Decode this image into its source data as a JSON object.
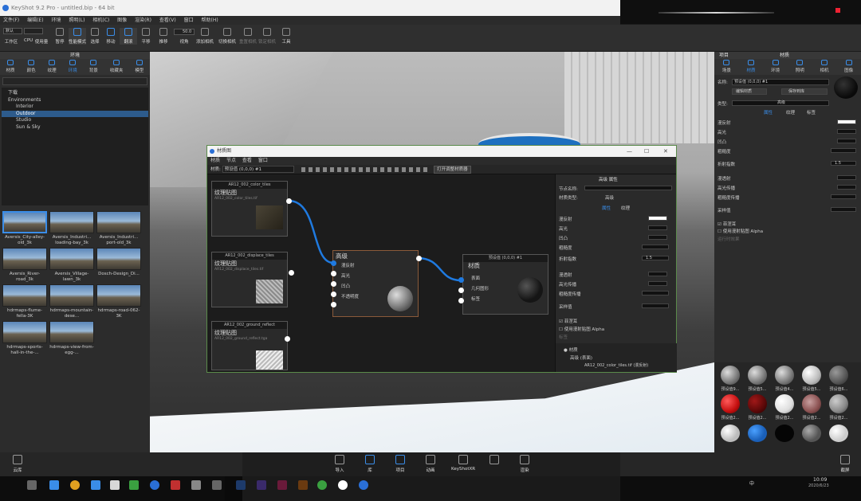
{
  "window": {
    "title": "KeyShot 9.2 Pro - untitled.bip - 64 bit"
  },
  "menubar": [
    "文件(F)",
    "编辑(E)",
    "环境",
    "照明(L)",
    "相机(C)",
    "图像",
    "渲染(R)",
    "查看(V)",
    "窗口",
    "帮助(H)"
  ],
  "toolbar": {
    "workspace": "默认",
    "cpu": "CPU",
    "cpu_usage": "使用量",
    "pause": "暂停",
    "perf": "性能模式",
    "items": [
      "选择",
      "移动",
      "翻滚",
      "平移",
      "推移",
      "视角",
      "添加相机",
      "切换相机",
      "重置相机",
      "锁定相机",
      "工具"
    ],
    "zoom": "50.0"
  },
  "left_panel": {
    "title": "环境",
    "tabs": [
      "材质",
      "颜色",
      "纹理",
      "环境",
      "背景",
      "收藏夹",
      "模型"
    ],
    "tree": [
      "下载",
      "Environments",
      "Interior",
      "Outdoor",
      "Studio",
      "Sun & Sky"
    ],
    "thumbs": [
      "Aversis_City-alley-old_3k",
      "Aversis_Industri... loading-bay_3k",
      "Aversis_Industri... port-old_3k",
      "Aversis_River-road_3k",
      "Aversis_Village-lawn_3k",
      "Dosch-Design_Di...",
      "hdrmaps-flume-fella-3K",
      "hdrmaps-mountain-dese...",
      "hdrmaps-road-062-3K",
      "hdrmaps-sports-hall-in-the-...",
      "hdrmaps-view-from-egg-..."
    ]
  },
  "node_window": {
    "title": "材质图",
    "menu": [
      "材质",
      "节点",
      "查看",
      "窗口"
    ],
    "material_label": "材质:",
    "material_value": "预设值 (0,0,0) #1",
    "tool_btn": "打开调整材质器",
    "nodes": {
      "tex1_header": "AR12_002_color_tiles",
      "tex1_title": "纹理贴图",
      "tex1_file": "AR12_002_color_tiles.tif",
      "tex2_header": "AR12_002_displace_tiles",
      "tex2_title": "纹理贴图",
      "tex2_file": "AR12_002_displace_tiles.tif",
      "tex3_header": "AR12_002_ground_reflect",
      "tex3_title": "纹理贴图",
      "tex3_file": "AR12_002_ground_reflect.tga",
      "mat_title": "高级",
      "mat_ports": [
        "漫反射",
        "高光",
        "凹凸",
        "不透明度",
        ""
      ],
      "out_header": "预设值 (0,0,0) #1",
      "out_title": "材质",
      "out_ports": [
        "表面",
        "几何图形",
        "标签"
      ]
    },
    "props": {
      "title": "高级 属性",
      "name_label": "节点名称:",
      "type_label": "材质类型:",
      "type_value": "高级",
      "tabs": [
        "属性",
        "纹理"
      ],
      "rows": [
        "漫反射",
        "高光",
        "凹凸",
        "粗糙度",
        "折射指数",
        "漫透射",
        "高光传播",
        "粗糙度传播",
        "采样值",
        "菲涅耳",
        "使用漫射贴图 Alpha",
        "标签"
      ],
      "ior": "1.5",
      "list": [
        "材质",
        "高级 (表面)",
        "AR12_002_color_tiles.tif (漫反射)"
      ]
    }
  },
  "right_panel": {
    "tabs": [
      "项目",
      "材质"
    ],
    "subtabs": [
      "场景",
      "材质",
      "环境",
      "照明",
      "相机",
      "图像"
    ],
    "name_label": "名称:",
    "name_value": "预设值 (0,0,0) #1",
    "btn1": "编辑材质",
    "btn2": "保存到库",
    "type_label": "类型:",
    "type_value": "高级",
    "tabs2": [
      "属性",
      "纹理",
      "标签"
    ],
    "rows": [
      "漫反射",
      "高光",
      "凹凸",
      "粗糙度",
      "折射指数",
      "漫透射",
      "高光传播",
      "粗糙度传播",
      "采样值",
      "菲涅耳",
      "使用漫射贴图 Alpha",
      "运行时效果"
    ],
    "ior": "1.5",
    "swatches": [
      "预设值9...",
      "预设值5...",
      "预设值4...",
      "预设值5...",
      "预设值6...",
      "预设值2...",
      "预设值2...",
      "预设值2...",
      "预设值2...",
      "预设值2..."
    ]
  },
  "bottom": {
    "left": "云库",
    "items": [
      "导入",
      "库",
      "项目",
      "动画",
      "KeyShotXR",
      "",
      "渲染"
    ],
    "right": "截屏"
  },
  "taskbar": {
    "time": "10:09",
    "date": "2020/6/23",
    "lang": "中"
  }
}
